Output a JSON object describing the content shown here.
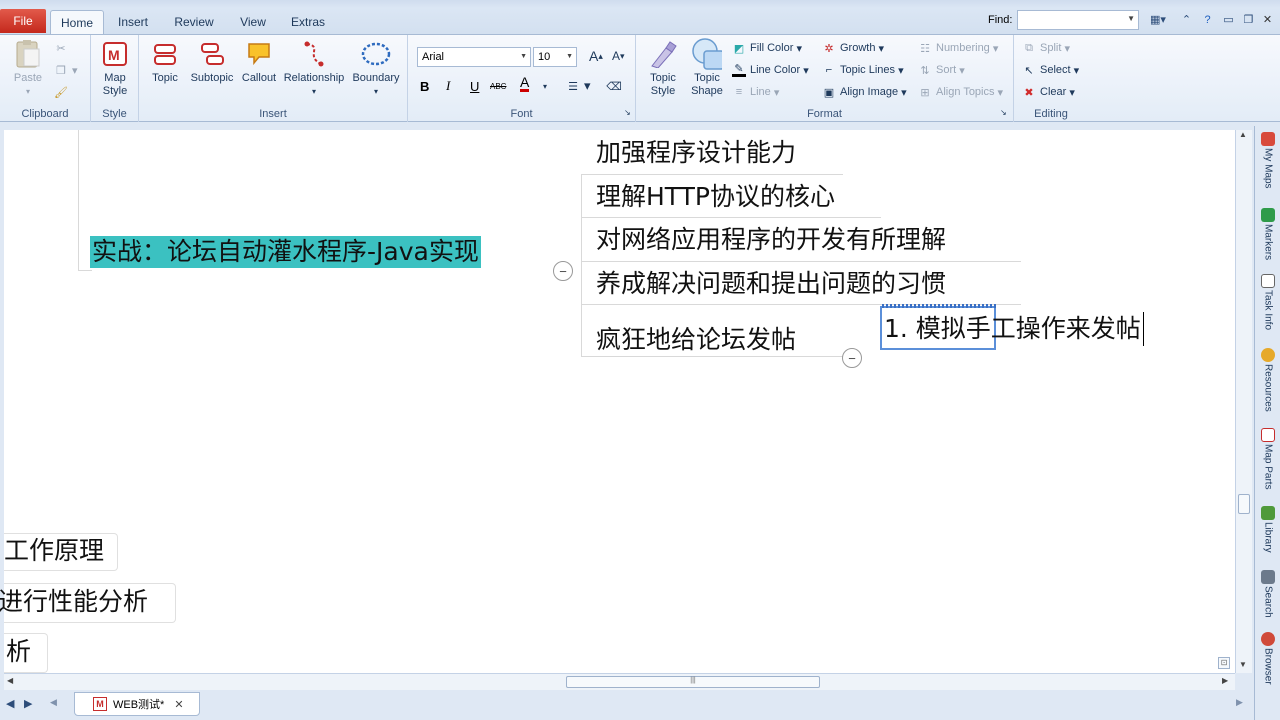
{
  "tabs": {
    "file": "File",
    "home": "Home",
    "insert": "Insert",
    "review": "Review",
    "view": "View",
    "extras": "Extras"
  },
  "find": {
    "label": "Find:",
    "value": ""
  },
  "ribbon": {
    "clipboard": {
      "label": "Clipboard",
      "paste": "Paste"
    },
    "style": {
      "label": "Style",
      "map_style": "Map\nStyle"
    },
    "insert": {
      "label": "Insert",
      "topic": "Topic",
      "subtopic": "Subtopic",
      "callout": "Callout",
      "relationship": "Relationship",
      "boundary": "Boundary"
    },
    "font": {
      "label": "Font",
      "family": "Arial",
      "size": "10",
      "bold": "B",
      "italic": "I",
      "underline": "U",
      "strike": "ABC",
      "color": "A"
    },
    "format": {
      "label": "Format",
      "topic_style": "Topic\nStyle",
      "topic_shape": "Topic\nShape",
      "fill_color": "Fill Color",
      "line_color": "Line Color",
      "line": "Line",
      "growth": "Growth",
      "topic_lines": "Topic Lines",
      "align_image": "Align Image",
      "numbering": "Numbering",
      "sort": "Sort",
      "align_topics": "Align Topics"
    },
    "editing": {
      "label": "Editing",
      "split": "Split",
      "select": "Select",
      "clear": "Clear"
    }
  },
  "map": {
    "central": "实战：论坛自动灌水程序-Java实现",
    "subtopics": [
      "加强程序设计能力",
      "理解HTTP协议的核心",
      "对网络应用程序的开发有所理解",
      "养成解决问题和提出问题的习惯",
      "疯狂地给论坛发帖"
    ],
    "editing_topic": "1. 模拟手工操作来发帖",
    "left_partial": [
      "工作原理",
      "进行性能分析",
      "析"
    ]
  },
  "side_tabs": [
    "My Maps",
    "Markers",
    "Task Info",
    "Resources",
    "Map Parts",
    "Library",
    "Search",
    "Browser"
  ],
  "doc_tab": "WEB测试*",
  "colors": {
    "accent": "#3bc1c1",
    "file_tab": "#d03a2c",
    "ribbon_bg": "#e3ecf7"
  }
}
